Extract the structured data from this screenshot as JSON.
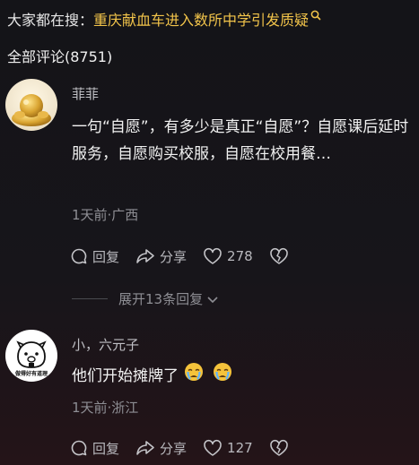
{
  "search": {
    "prefix": "大家都在搜：",
    "query": "重庆献血车进入数所中学引发质疑"
  },
  "comments_header": "全部评论(8751)",
  "comments": [
    {
      "username": "菲菲",
      "text": "一句“自愿”，有多少是真正“自愿”？自愿课后延时服务，自愿购买校服，自愿在校用餐…",
      "meta": "1天前·广西",
      "reply_label": "回复",
      "share_label": "分享",
      "like_count": "278",
      "expand_label": "展开13条回复"
    },
    {
      "username": "小，六元子",
      "text": "他们开始摊牌了",
      "meta": "1天前·浙江",
      "reply_label": "回复",
      "share_label": "分享",
      "like_count": "127",
      "avatar_text": "做得好有道理"
    }
  ]
}
